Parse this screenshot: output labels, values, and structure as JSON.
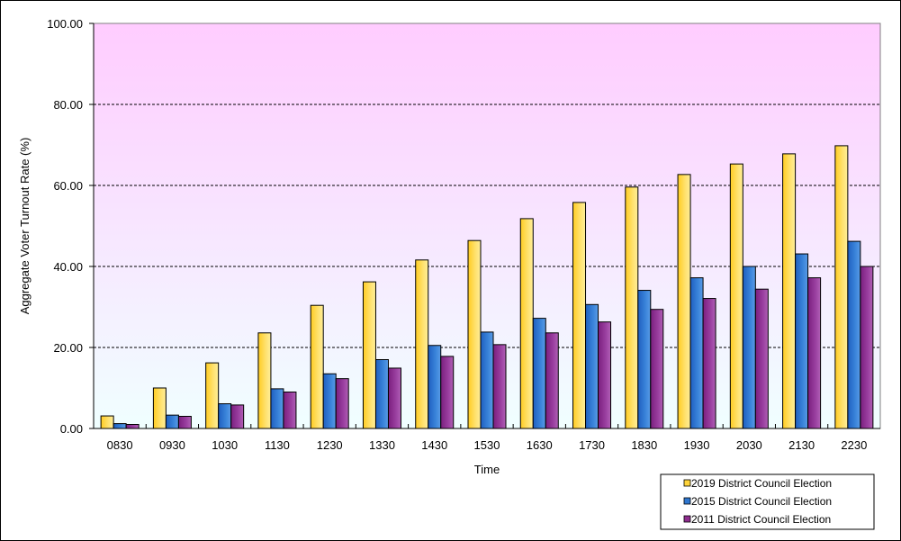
{
  "chart_data": {
    "type": "bar",
    "title": "",
    "xlabel": "Time",
    "ylabel": "Aggregate Voter Turnout Rate (%)",
    "ylim": [
      0,
      100
    ],
    "yticks": [
      "0.00",
      "20.00",
      "40.00",
      "60.00",
      "80.00",
      "100.00"
    ],
    "ytick_values": [
      0,
      20,
      40,
      60,
      80,
      100
    ],
    "grid": true,
    "legend_position": "bottom-right",
    "categories": [
      "0830",
      "0930",
      "1030",
      "1130",
      "1230",
      "1330",
      "1430",
      "1530",
      "1630",
      "1730",
      "1830",
      "1930",
      "2030",
      "2130",
      "2230"
    ],
    "series": [
      {
        "name": "2019 District Council Election",
        "color": "#FFD43B",
        "values": [
          3.1,
          10.0,
          16.2,
          23.6,
          30.4,
          36.2,
          41.6,
          46.4,
          51.8,
          55.8,
          59.6,
          62.7,
          65.3,
          67.8,
          69.8
        ]
      },
      {
        "name": "2015 District Council Election",
        "color": "#2F77D0",
        "values": [
          1.2,
          3.3,
          6.1,
          9.8,
          13.5,
          17.0,
          20.5,
          23.8,
          27.2,
          30.6,
          34.1,
          37.2,
          40.0,
          43.1,
          46.2
        ]
      },
      {
        "name": "2011 District Council Election",
        "color": "#8E2D8E",
        "values": [
          1.0,
          3.0,
          5.8,
          9.0,
          12.3,
          14.9,
          17.8,
          20.7,
          23.6,
          26.3,
          29.4,
          32.1,
          34.4,
          37.2,
          40.0
        ]
      }
    ],
    "background_gradient": [
      "#FFCCFF",
      "#F0FFFF"
    ]
  }
}
